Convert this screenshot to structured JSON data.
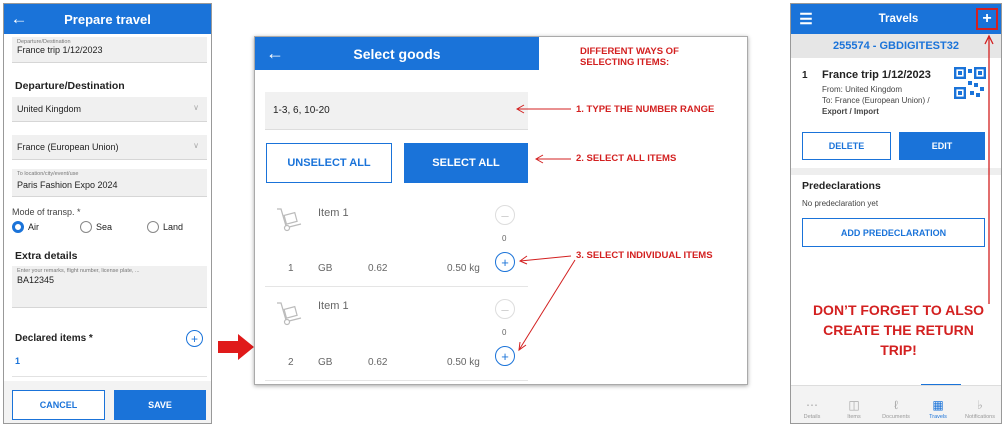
{
  "prepare": {
    "title": "Prepare travel",
    "trip_name_label": "Departure/Destination",
    "trip_name_value": "France trip 1/12/2023",
    "section_departure": "Departure/Destination",
    "departure_value": "United Kingdom",
    "destination_value": "France (European Union)",
    "location_label": "To location/city/event/use",
    "location_value": "Paris Fashion Expo 2024",
    "mode_label": "Mode of transp. *",
    "modes": [
      "Air",
      "Sea",
      "Land"
    ],
    "mode_selected": "Air",
    "section_extra": "Extra details",
    "remarks_placeholder": "Enter your remarks, flight number, license plate, ...",
    "remarks_value": "BA12345",
    "declared_label": "Declared items *",
    "declared_count": "1",
    "cancel_label": "CANCEL",
    "save_label": "SAVE"
  },
  "select": {
    "title": "Select goods",
    "range_value": "1-3, 6, 10-20",
    "unselect_label": "UNSELECT ALL",
    "select_label": "SELECT ALL",
    "items": [
      {
        "name": "Item 1",
        "number": "1",
        "origin": "GB",
        "value": "0.62",
        "weight": "0.50 kg",
        "qty": "0"
      },
      {
        "name": "Item 1",
        "number": "2",
        "origin": "GB",
        "value": "0.62",
        "weight": "0.50 kg",
        "qty": "0"
      }
    ]
  },
  "annotations": {
    "heading_line1": "DIFFERENT WAYS OF",
    "heading_line2": "SELECTING ITEMS:",
    "step1": "1. TYPE THE NUMBER RANGE",
    "step2": "2. SELECT ALL ITEMS",
    "step3": "3. SELECT INDIVIDUAL ITEMS",
    "reminder": "DON’T  FORGET TO ALSO CREATE THE RETURN TRIP!"
  },
  "travels": {
    "title": "Travels",
    "account": "255574 - GBDIGITEST32",
    "trip_index": "1",
    "trip_name": "France trip 1/12/2023",
    "from_line": "From: United Kingdom",
    "to_line": "To: France (European Union) /",
    "type_line": "Export / Import",
    "delete_label": "DELETE",
    "edit_label": "EDIT",
    "predecl_title": "Predeclarations",
    "predecl_empty": "No predeclaration yet",
    "add_predecl_label": "ADD PREDECLARATION",
    "nav": [
      "Details",
      "Items",
      "Documents",
      "Travels",
      "Notifications"
    ],
    "nav_active": "Travels"
  },
  "colors": {
    "accent": "#1a73d9",
    "annotation": "#d32020"
  }
}
